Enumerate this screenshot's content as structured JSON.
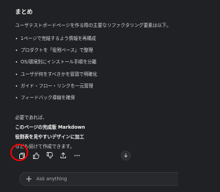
{
  "chat": {
    "heading": "まとめ",
    "intro": "ユーザテストボードページを作る際の主要なリファクタリング要素は以下。",
    "bullets": [
      "1ページで完結するよう情報を再構成",
      "プロダクトを「役割ベース」で整理",
      "OS/環境別にインストール手順を分離",
      "ユーザが何をすべきかを冒頭で明確化",
      "ガイド・フロー・リンクを一元管理",
      "フィードバック導線を確保"
    ],
    "closing": {
      "line1": "必要であれば、",
      "line2": "このページの完成版 Markdown",
      "line3": "役割表を見やすいデザインに加工",
      "line4": "なども続けて作成できます。"
    }
  },
  "toolbar": {
    "icons": [
      "copy-icon",
      "thumbs-up-icon",
      "thumbs-down-icon",
      "share-icon",
      "more-icon"
    ],
    "scroll_icon": "arrow-down-icon",
    "highlight_color": "#ff0000"
  },
  "composer": {
    "placeholder": "Ask anything",
    "plus_icon": "plus-icon"
  },
  "theme": {
    "background": "#202124",
    "text": "#d9d9db"
  }
}
